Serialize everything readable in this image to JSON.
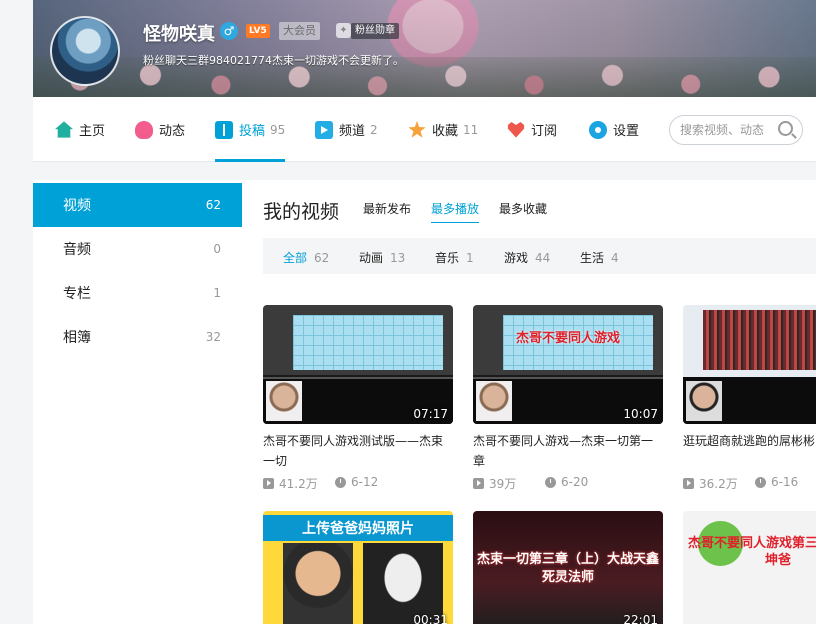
{
  "profile": {
    "username": "怪物咲真",
    "gender_icon": "♂",
    "level": "LV5",
    "vip": "大会员",
    "medal": "粉丝勋章",
    "sign": "粉丝聊天三群984021774杰束一切游戏不会更新了。"
  },
  "nav": {
    "items": [
      {
        "label": "主页",
        "count": "",
        "icon": "home-icon"
      },
      {
        "label": "动态",
        "count": "",
        "icon": "dynamic-icon"
      },
      {
        "label": "投稿",
        "count": "95",
        "icon": "upload-icon"
      },
      {
        "label": "频道",
        "count": "2",
        "icon": "channel-icon"
      },
      {
        "label": "收藏",
        "count": "11",
        "icon": "favorite-icon"
      },
      {
        "label": "订阅",
        "count": "",
        "icon": "subscribe-icon"
      },
      {
        "label": "设置",
        "count": "",
        "icon": "settings-icon"
      }
    ],
    "search_placeholder": "搜索视频、动态"
  },
  "sidebar": {
    "items": [
      {
        "label": "视频",
        "count": "62"
      },
      {
        "label": "音频",
        "count": "0"
      },
      {
        "label": "专栏",
        "count": "1"
      },
      {
        "label": "相簿",
        "count": "32"
      }
    ]
  },
  "main": {
    "title": "我的视频",
    "sort_tabs": [
      "最新发布",
      "最多播放",
      "最多收藏"
    ],
    "filters": [
      {
        "label": "全部",
        "count": "62"
      },
      {
        "label": "动画",
        "count": "13"
      },
      {
        "label": "音乐",
        "count": "1"
      },
      {
        "label": "游戏",
        "count": "44"
      },
      {
        "label": "生活",
        "count": "4"
      }
    ]
  },
  "videos": [
    {
      "title": "杰哥不要同人游戏测试版——杰束一切",
      "duration": "07:17",
      "plays": "41.2万",
      "date": "6-12",
      "thumb_text": ""
    },
    {
      "title": "杰哥不要同人游戏—杰束一切第一章",
      "duration": "10:07",
      "plays": "39万",
      "date": "6-20",
      "thumb_text": "杰哥不要同人游戏"
    },
    {
      "title": "逛玩超商就逃跑的屌彬彬",
      "duration": "",
      "plays": "36.2万",
      "date": "6-16",
      "thumb_text": ""
    },
    {
      "title": "",
      "duration": "00:31",
      "plays": "",
      "date": "",
      "thumb_text": "上传爸爸妈妈照片"
    },
    {
      "title": "",
      "duration": "22:01",
      "plays": "",
      "date": "",
      "thumb_text": "杰束一切第三章（上）大战天鑫死灵法师"
    },
    {
      "title": "",
      "duration": "",
      "plays": "",
      "date": "",
      "thumb_text": "杰哥不要同人游戏第三 彬彬VS坤爸"
    }
  ],
  "colors": {
    "accent": "#00a1d6",
    "level": "#ff7a24"
  }
}
